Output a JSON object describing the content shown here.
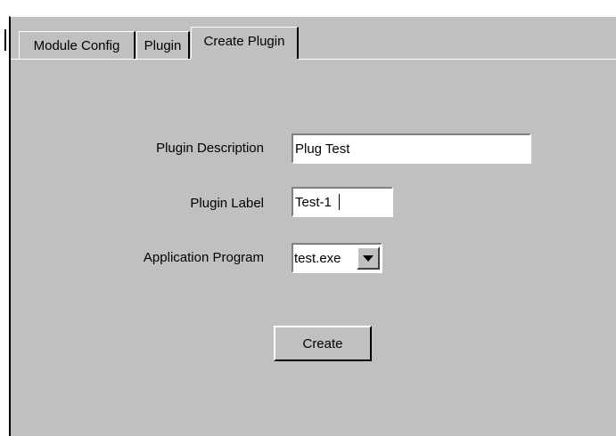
{
  "tabs": [
    {
      "label": "Module Config"
    },
    {
      "label": "Plugin"
    },
    {
      "label": "Create Plugin",
      "active": true
    }
  ],
  "form": {
    "plugin_description": {
      "label": "Plugin Description",
      "value": "Plug Test"
    },
    "plugin_label": {
      "label": "Plugin Label",
      "value": "Test-1"
    },
    "application_program": {
      "label": "Application Program",
      "selected": "test.exe"
    },
    "create_button_label": "Create"
  },
  "colors": {
    "panel": "#c0c0c0",
    "field_background": "#ffffff",
    "text": "#000000"
  },
  "icons": {
    "select_arrow": "chevron-down-icon"
  }
}
